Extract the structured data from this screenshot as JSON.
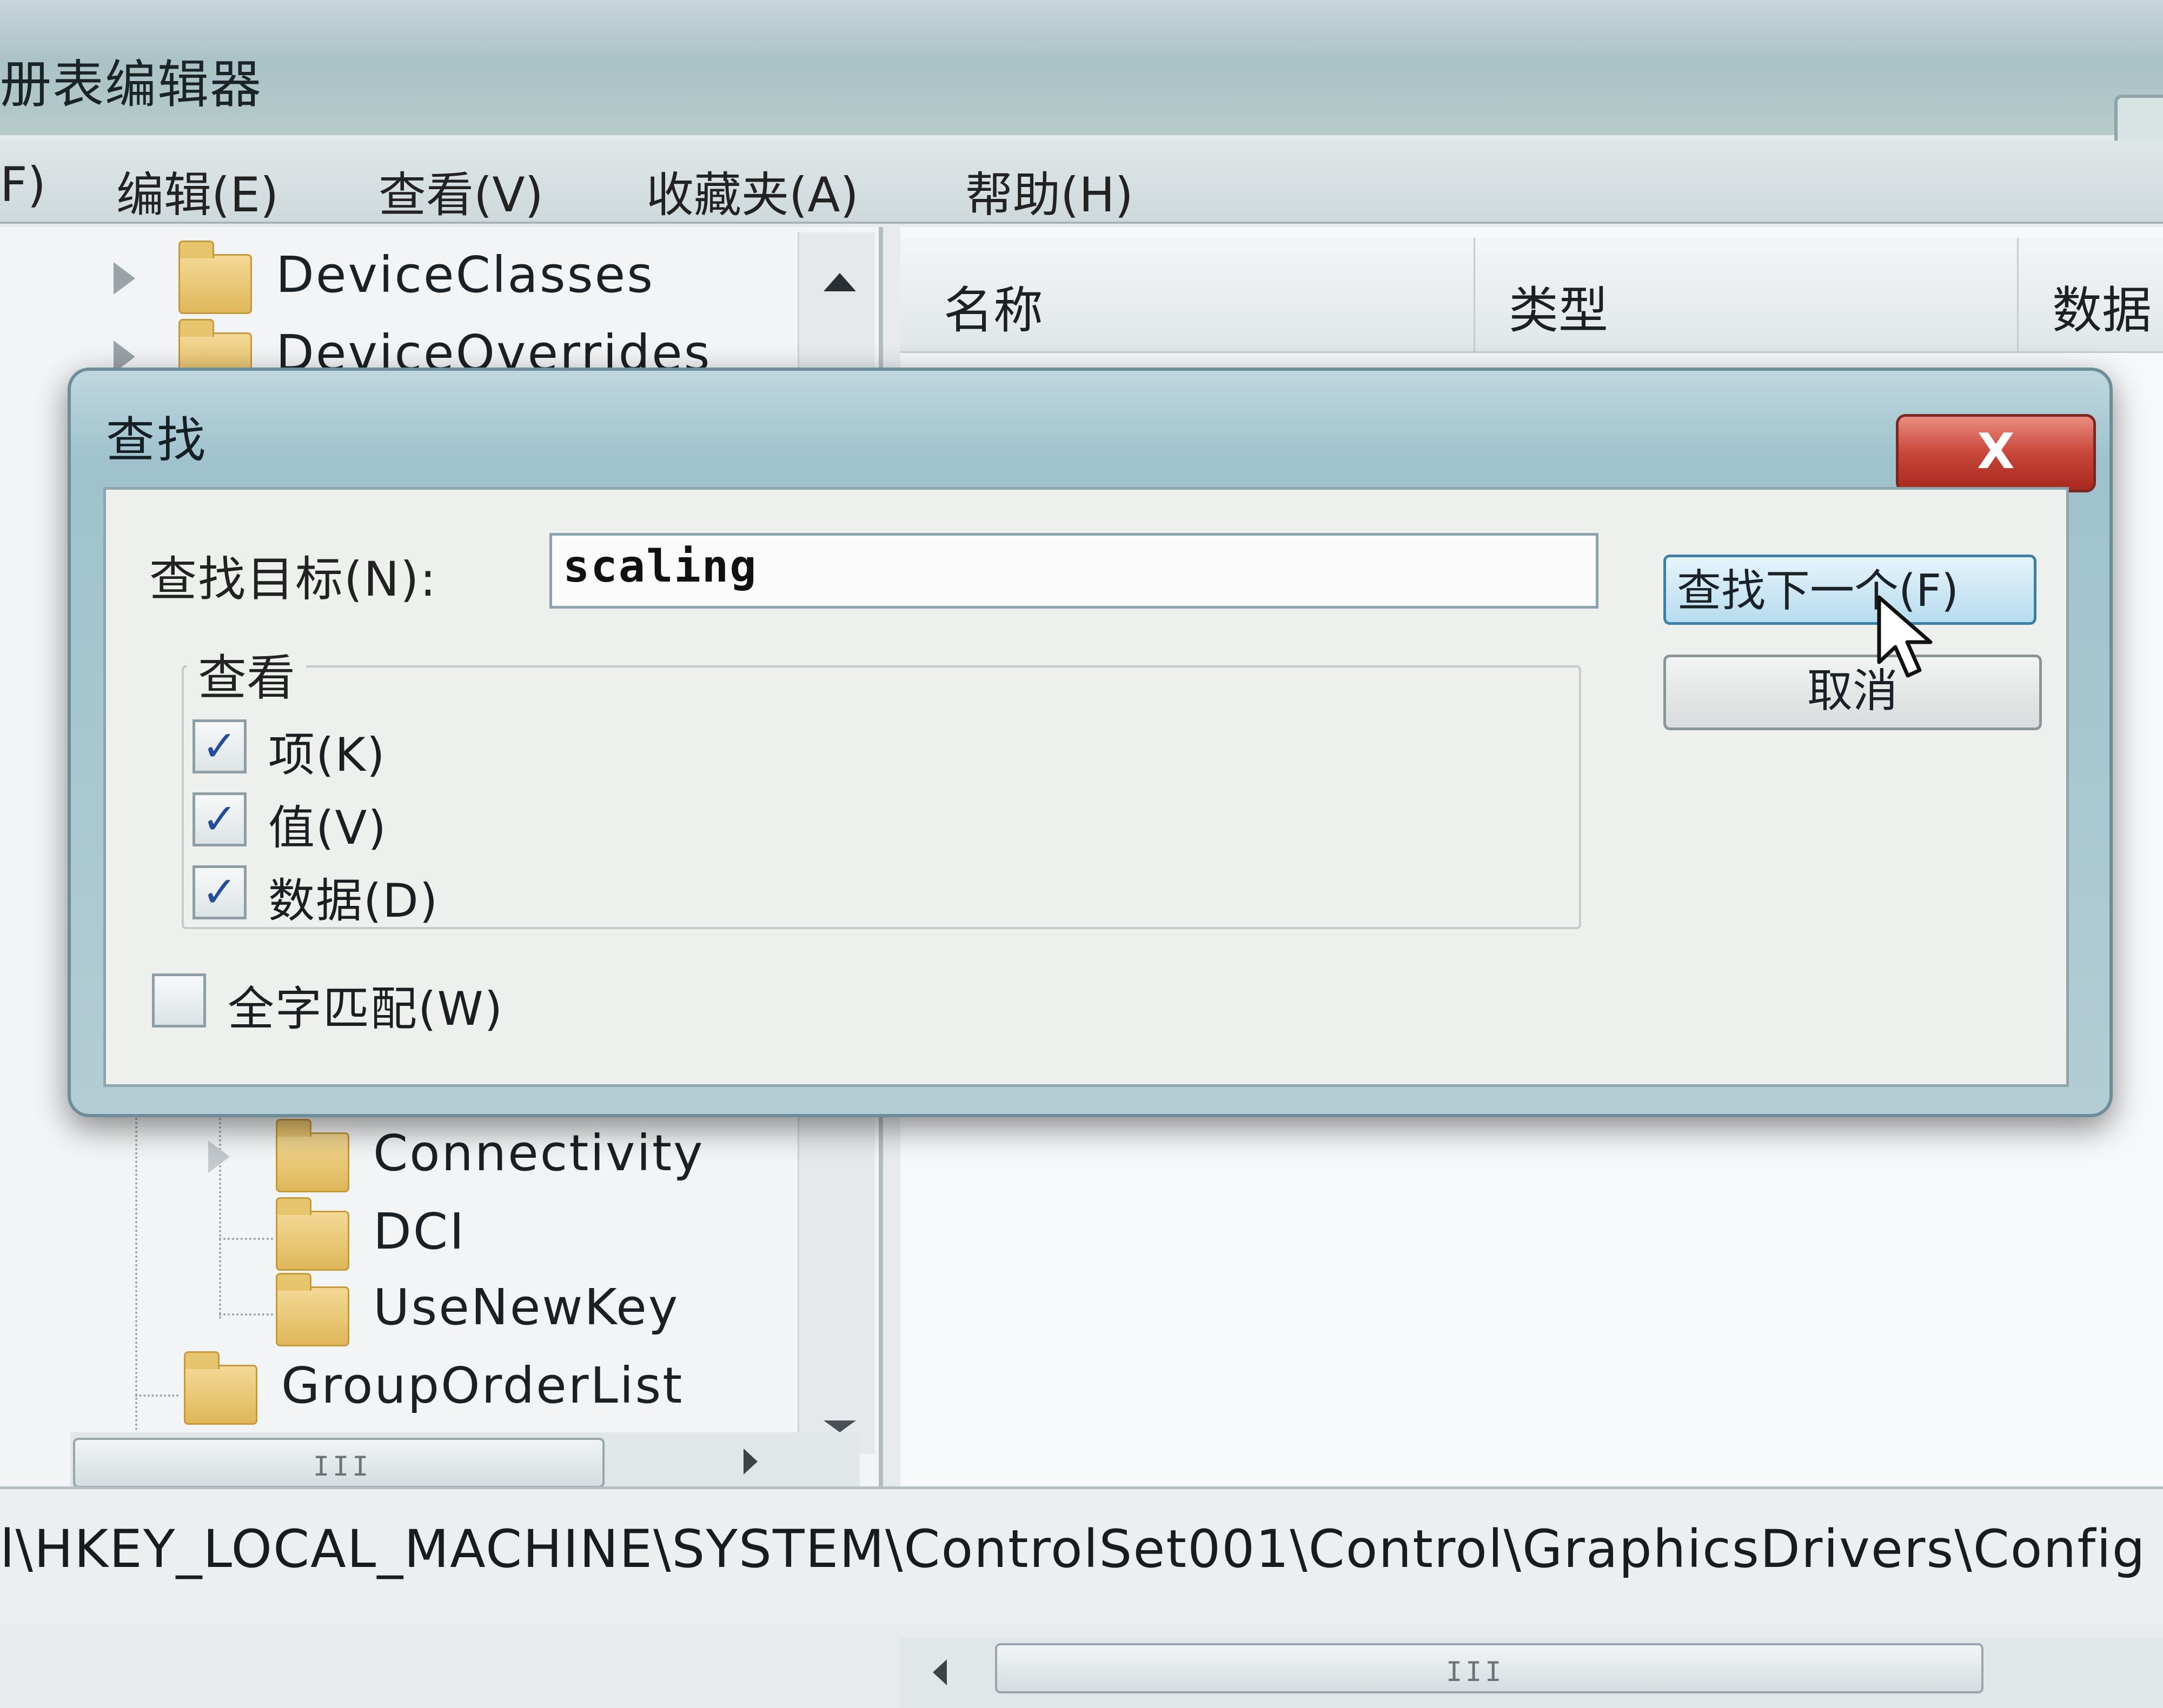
{
  "window": {
    "title": "册表编辑器",
    "menu": [
      "F)",
      "编辑(E)",
      "查看(V)",
      "收藏夹(A)",
      "帮助(H)"
    ]
  },
  "tree": {
    "top_items": [
      "DeviceClasses",
      "DeviceOverrides"
    ],
    "child_items": [
      "Connectivity",
      "DCI",
      "UseNewKey"
    ],
    "bottom_item": "GroupOrderList",
    "scroll_grip": "III"
  },
  "list": {
    "columns": [
      "名称",
      "类型",
      "数据"
    ],
    "scroll_grip": "III"
  },
  "status": {
    "path": "l\\HKEY_LOCAL_MACHINE\\SYSTEM\\ControlSet001\\Control\\GraphicsDrivers\\Config"
  },
  "dialog": {
    "title": "查找",
    "close_label": "X",
    "find_label": "查找目标(N):",
    "find_value": "scaling",
    "find_next_label": "查找下一个(F)",
    "cancel_label": "取消",
    "look_at_legend": "查看",
    "options": [
      {
        "label": "项(K)",
        "checked": true
      },
      {
        "label": "值(V)",
        "checked": true
      },
      {
        "label": "数据(D)",
        "checked": true
      }
    ],
    "match_whole": {
      "label": "全字匹配(W)",
      "checked": false
    },
    "check_mark": "✓"
  }
}
